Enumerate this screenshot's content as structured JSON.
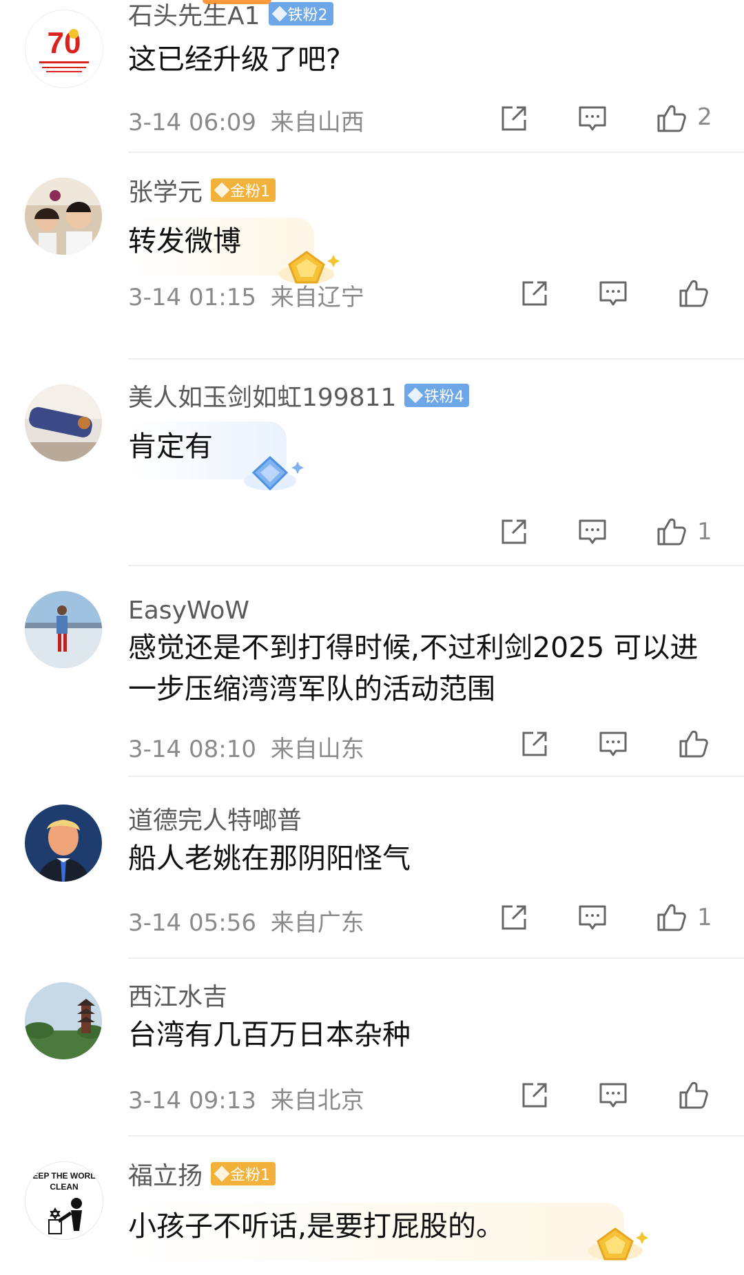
{
  "comments": [
    {
      "user": "石头先生A1",
      "badge": {
        "type": "iron",
        "label": "铁粉2"
      },
      "text": "这已经升级了吧?",
      "time": "3-14 06:09",
      "location": "来自山西",
      "likes": "2"
    },
    {
      "user": "张学元",
      "badge": {
        "type": "gold",
        "label": "金粉1"
      },
      "text": "转发微博",
      "time": "3-14 01:15",
      "location": "来自辽宁",
      "likes": ""
    },
    {
      "user": "美人如玉剑如虹199811",
      "badge": {
        "type": "iron",
        "label": "铁粉4"
      },
      "text": "肯定有",
      "time": "",
      "location": "",
      "likes": "1"
    },
    {
      "user": "EasyWoW",
      "badge": null,
      "text": "感觉还是不到打得时候,不过利剑2025 可以进一步压缩湾湾军队的活动范围",
      "time": "3-14 08:10",
      "location": "来自山东",
      "likes": ""
    },
    {
      "user": "道德完人特啷普",
      "badge": null,
      "text": "船人老姚在那阴阳怪气",
      "time": "3-14 05:56",
      "location": "来自广东",
      "likes": "1"
    },
    {
      "user": "西江水吉",
      "badge": null,
      "text": "台湾有几百万日本杂种",
      "time": "3-14 09:13",
      "location": "来自北京",
      "likes": ""
    },
    {
      "user": "福立扬",
      "badge": {
        "type": "gold",
        "label": "金粉1"
      },
      "text": "小孩子不听话,是要打屁股的。",
      "time": "",
      "location": "",
      "likes": ""
    }
  ],
  "avatar_text": {
    "first": "70",
    "last_line1": "KEEP THE WORLD",
    "last_line2": "CLEAN"
  },
  "icons": {
    "share": "share-icon",
    "comment": "comment-icon",
    "like": "thumbs-up-icon"
  },
  "colors": {
    "iron_badge": "#6ea7e8",
    "gold_badge": "#f2b13a",
    "meta_text": "#8a8a8a",
    "accent": "#ff9a3c"
  }
}
